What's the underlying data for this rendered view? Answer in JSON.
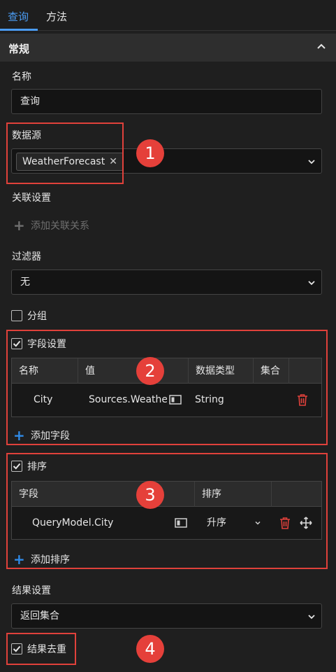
{
  "tabs": [
    {
      "label": "查询"
    },
    {
      "label": "方法"
    }
  ],
  "section": {
    "title": "常规"
  },
  "name_field": {
    "label": "名称",
    "value": "查询"
  },
  "datasource": {
    "label": "数据源",
    "tag": "WeatherForecast"
  },
  "relation": {
    "label": "关联设置",
    "add_label": "添加关联关系"
  },
  "filter": {
    "label": "过滤器",
    "value": "无"
  },
  "group": {
    "label": "分组",
    "checked": false
  },
  "fields": {
    "label": "字段设置",
    "checked": true,
    "columns": [
      "名称",
      "值",
      "数据类型",
      "集合"
    ],
    "rows": [
      {
        "name": "City",
        "value": "Sources.Weather",
        "type": "String"
      }
    ],
    "add_label": "添加字段"
  },
  "sort": {
    "label": "排序",
    "checked": true,
    "columns": [
      "字段",
      "排序"
    ],
    "rows": [
      {
        "field": "QueryModel.City",
        "order": "升序"
      }
    ],
    "add_label": "添加排序"
  },
  "result": {
    "label": "结果设置",
    "value": "返回集合"
  },
  "distinct": {
    "label": "结果去重",
    "checked": true
  },
  "badges": [
    "1",
    "2",
    "3",
    "4"
  ],
  "colors": {
    "accent": "#4b9cf3",
    "highlight": "#e0413b",
    "delete": "#e0413b"
  }
}
